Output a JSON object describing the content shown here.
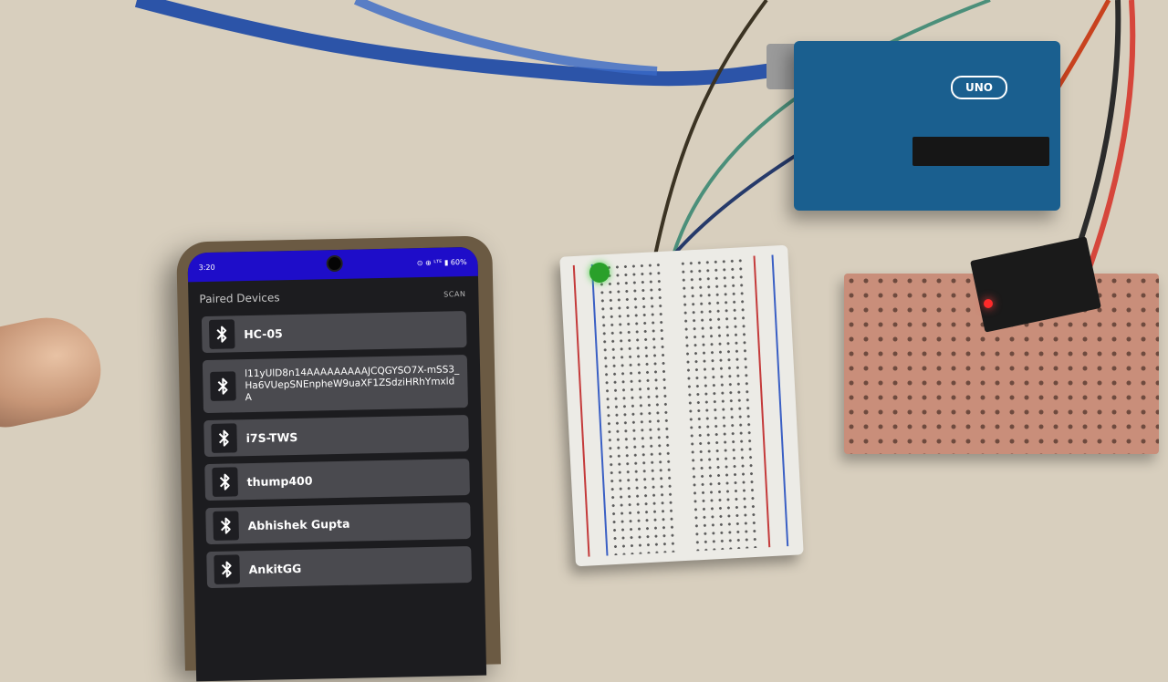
{
  "status_bar": {
    "time": "3:20",
    "icons_text": "⊙ ⊕ ᴸᵀᴱ ▮ 60%"
  },
  "app_bar": {
    "title": "Paired Devices",
    "scan_label": "SCAN"
  },
  "devices": [
    {
      "name": "HC-05",
      "icon": "bluetooth-icon"
    },
    {
      "name": "l11yUlD8n14AAAAAAAAAJCQGYSO7X-mSS3_Ha6VUepSNEnpheW9uaXF1ZSdziHRhYmxldA",
      "icon": "bluetooth-icon"
    },
    {
      "name": "i7S-TWS",
      "icon": "bluetooth-icon"
    },
    {
      "name": "thump400",
      "icon": "bluetooth-icon"
    },
    {
      "name": "Abhishek Gupta",
      "icon": "bluetooth-icon"
    },
    {
      "name": "AnkitGG",
      "icon": "bluetooth-icon"
    }
  ],
  "hardware": {
    "board_logo": "UNO"
  },
  "colors": {
    "status_bar": "#1e0dc9",
    "screen_bg": "#1c1c1f",
    "device_row": "#4a4a4f"
  }
}
